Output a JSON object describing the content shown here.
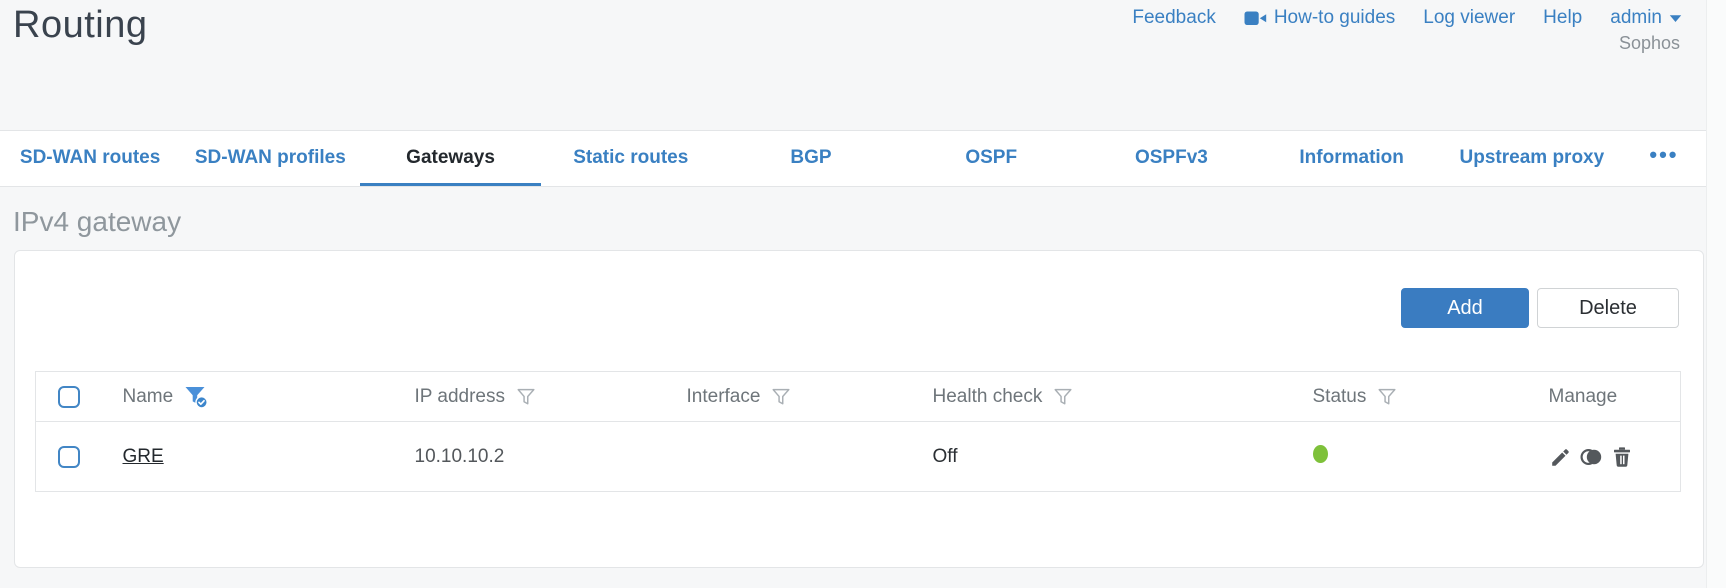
{
  "colors": {
    "accent": "#3A80C2",
    "button-blue": "#3A7CC1",
    "status-green": "#7EC13A",
    "title-gray": "#3A434E",
    "heading-gray": "#8F979D"
  },
  "header": {
    "title": "Routing",
    "nav": [
      {
        "label": "Feedback"
      },
      {
        "label": "How-to guides",
        "icon": "video-camera-icon"
      },
      {
        "label": "Log viewer"
      },
      {
        "label": "Help"
      },
      {
        "label": "admin",
        "icon": "caret-down-icon"
      }
    ],
    "brand": "Sophos"
  },
  "tabs": {
    "items": [
      {
        "label": "SD-WAN routes",
        "active": false
      },
      {
        "label": "SD-WAN profiles",
        "active": false
      },
      {
        "label": "Gateways",
        "active": true
      },
      {
        "label": "Static routes",
        "active": false
      },
      {
        "label": "BGP",
        "active": false
      },
      {
        "label": "OSPF",
        "active": false
      },
      {
        "label": "OSPFv3",
        "active": false
      },
      {
        "label": "Information",
        "active": false
      },
      {
        "label": "Upstream proxy",
        "active": false
      }
    ],
    "more_label": "•••"
  },
  "section": {
    "heading": "IPv4 gateway"
  },
  "toolbar": {
    "add_label": "Add",
    "delete_label": "Delete"
  },
  "table": {
    "columns": [
      {
        "label": "Name",
        "filter": "active"
      },
      {
        "label": "IP address",
        "filter": "inactive"
      },
      {
        "label": "Interface",
        "filter": "inactive"
      },
      {
        "label": "Health check",
        "filter": "inactive"
      },
      {
        "label": "Status",
        "filter": "inactive"
      },
      {
        "label": "Manage",
        "filter": "none"
      }
    ],
    "rows": [
      {
        "name": "GRE",
        "ip_address": "10.10.10.2",
        "interface": "",
        "health_check": "Off",
        "status": "up"
      }
    ]
  }
}
